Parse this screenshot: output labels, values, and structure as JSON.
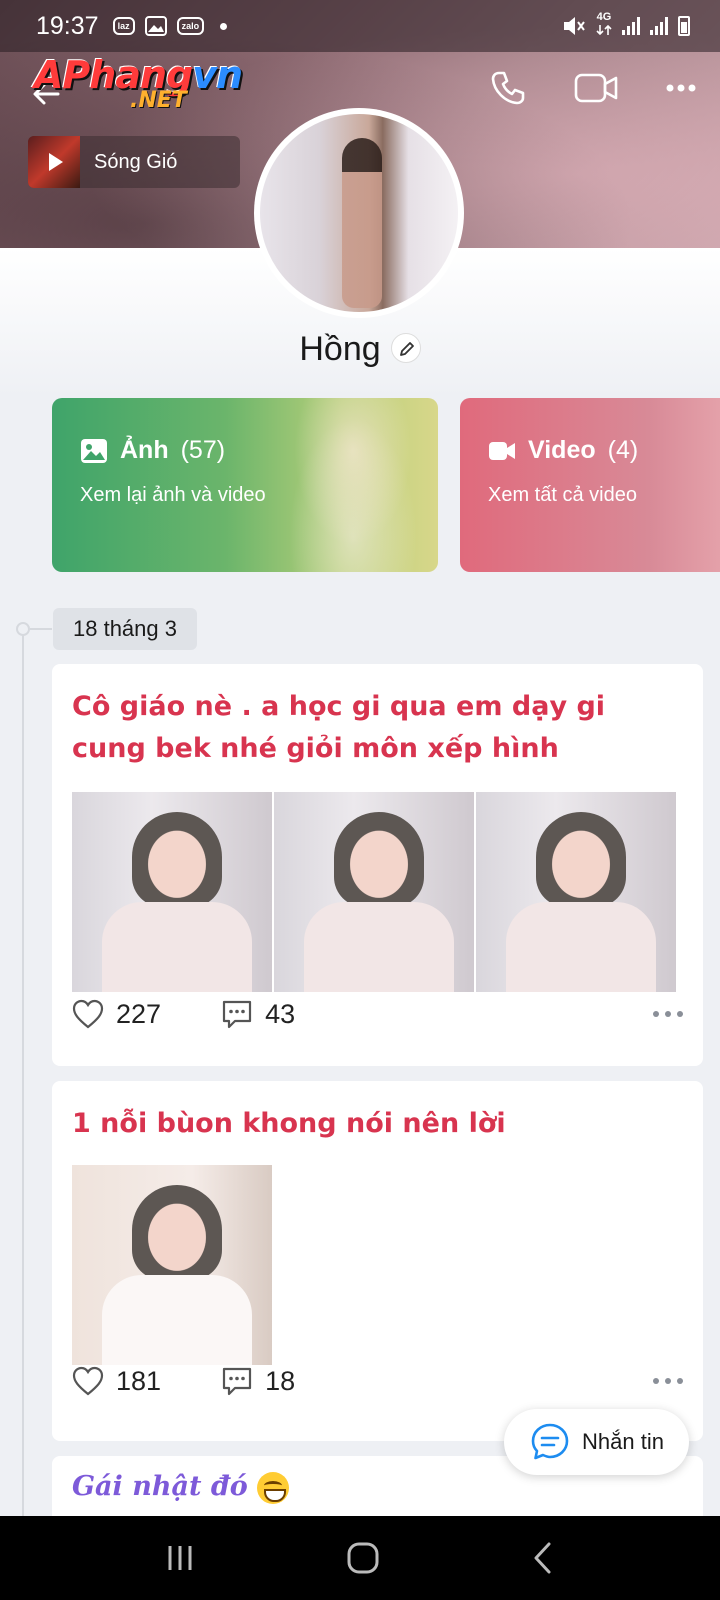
{
  "status_bar": {
    "time": "19:37",
    "apps": [
      "laz",
      "zalo"
    ],
    "network": "4G"
  },
  "watermark": {
    "main_red": "Phang",
    "main_blue": "vn",
    "prefix": "A",
    "sub": ".NET"
  },
  "header": {
    "music": {
      "title": "Sóng Gió"
    },
    "actions": [
      "phone-icon",
      "video-call-icon",
      "more-icon"
    ]
  },
  "profile": {
    "name": "Hồng"
  },
  "media_cards": {
    "photo": {
      "label": "Ảnh",
      "count": "(57)",
      "subtitle": "Xem lại ảnh và video",
      "color": "#3fa46a"
    },
    "video": {
      "label": "Video",
      "count": "(4)",
      "subtitle": "Xem tất cả video",
      "color": "#e06a7c"
    }
  },
  "timeline": {
    "date": "18 tháng 3"
  },
  "posts": [
    {
      "title": "Cô giáo nè .  a  học gi qua em dạy gi cung bek nhé giỏi môn xếp hình",
      "likes": "227",
      "comments": "43",
      "photo_count": 3
    },
    {
      "title": "1 nỗi bùon khong nói nên lời",
      "likes": "181",
      "comments": "18",
      "photo_count": 1
    },
    {
      "title": "Gái nhật đó"
    }
  ],
  "message_button": {
    "label": "Nhắn tin"
  },
  "colors": {
    "accent_red": "#d8344f",
    "accent_purple": "#7d5ad9",
    "blue": "#1d8cf0"
  }
}
